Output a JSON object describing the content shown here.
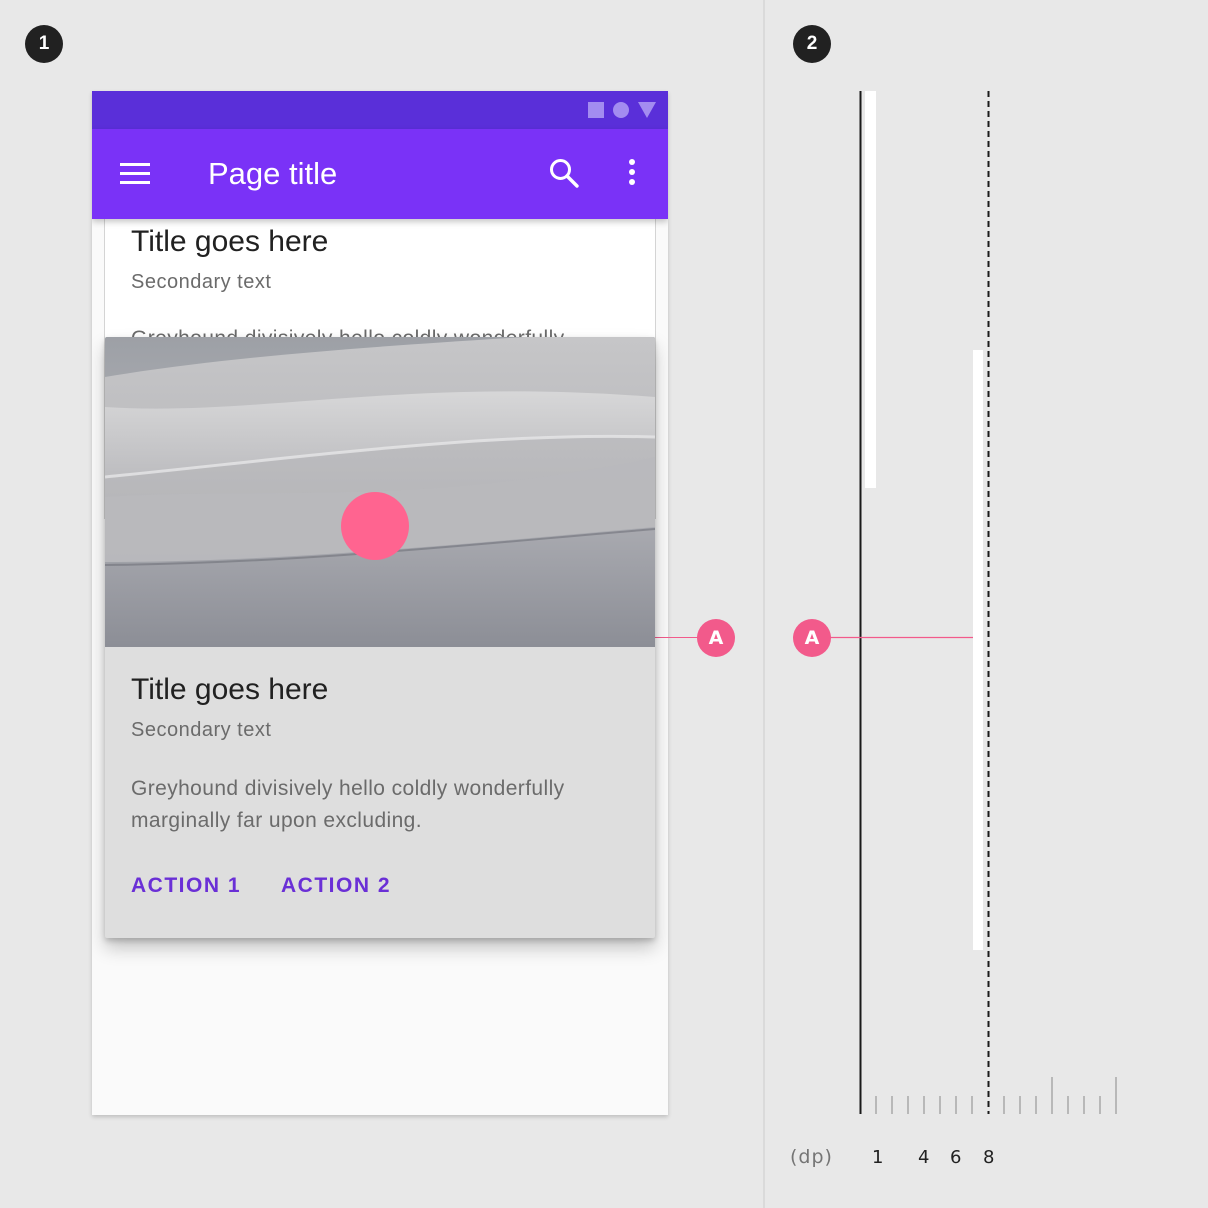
{
  "steps": {
    "first": "1",
    "second": "2"
  },
  "status_bar": {
    "icons": [
      "square-icon",
      "circle-icon",
      "triangle-icon"
    ]
  },
  "app_bar": {
    "title": "Page title",
    "icons": [
      "menu-icon",
      "search-icon",
      "more-vert-icon"
    ]
  },
  "background_card": {
    "title": "Title goes here",
    "secondary": "Secondary text",
    "body": "Greyhound divisively hello coldly wonderfully"
  },
  "raised_card": {
    "title": "Title goes here",
    "secondary": "Secondary text",
    "body": "Greyhound divisively hello coldly wonderfully marginally far upon excluding.",
    "actions": [
      "ACTION 1",
      "ACTION 2"
    ]
  },
  "annotation": {
    "label": "A"
  },
  "elevation_scale": {
    "unit": "(dp)",
    "tick_labels": [
      "1",
      "4",
      "6",
      "8"
    ]
  },
  "colors": {
    "status_bar": "#5a2fd9",
    "app_bar": "#7a32f7",
    "accent": "#f25a8b",
    "action_text": "#6a2fd6",
    "touch_dot": "#ff6490"
  }
}
